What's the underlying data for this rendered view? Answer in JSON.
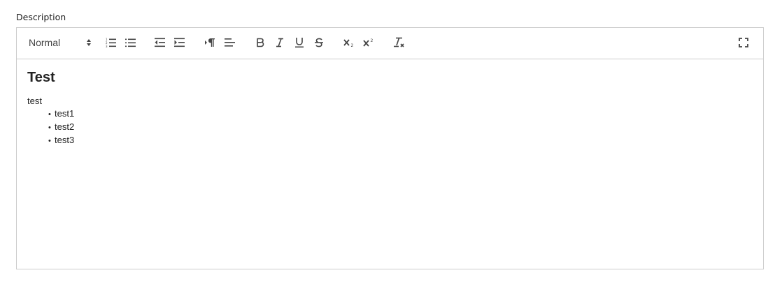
{
  "field": {
    "label": "Description"
  },
  "toolbar": {
    "header_select": {
      "value": "Normal",
      "icon": "updown-arrows-icon"
    },
    "buttons": [
      {
        "name": "ordered-list",
        "icon": "ordered-list-icon"
      },
      {
        "name": "bullet-list",
        "icon": "bullet-list-icon"
      },
      {
        "name": "outdent",
        "icon": "outdent-icon"
      },
      {
        "name": "indent",
        "icon": "indent-icon"
      },
      {
        "name": "text-direction",
        "icon": "rtl-paragraph-icon"
      },
      {
        "name": "align",
        "icon": "align-left-icon"
      },
      {
        "name": "bold",
        "icon": "bold-icon"
      },
      {
        "name": "italic",
        "icon": "italic-icon"
      },
      {
        "name": "underline",
        "icon": "underline-icon"
      },
      {
        "name": "strike",
        "icon": "strikethrough-icon"
      },
      {
        "name": "subscript",
        "icon": "subscript-icon"
      },
      {
        "name": "superscript",
        "icon": "superscript-icon"
      },
      {
        "name": "clear-format",
        "icon": "clear-format-icon"
      },
      {
        "name": "fullscreen",
        "icon": "fullscreen-icon"
      }
    ]
  },
  "content": {
    "heading": "Test",
    "paragraph": "test",
    "bullet_char": "•",
    "list_items": [
      "test1",
      "test2",
      "test3"
    ]
  }
}
